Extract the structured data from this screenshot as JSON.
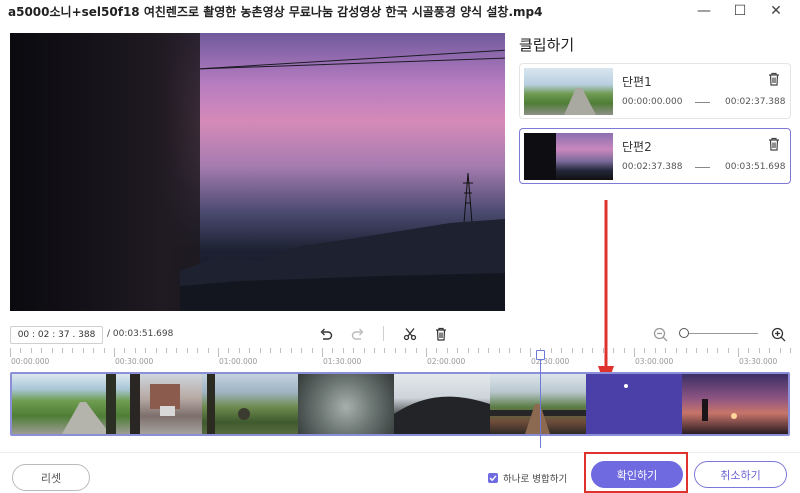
{
  "window": {
    "title": "a5000소니+sel50f18 여친렌즈로 촬영한 농촌영상 무료나눔 감성영상 한국 시골풍경 양식 설창.mp4",
    "min_glyph": "—",
    "max_glyph": "☐",
    "close_glyph": "✕"
  },
  "clip_panel": {
    "title": "클립하기",
    "clips": [
      {
        "name": "단편1",
        "start": "00:00:00.000",
        "end": "00:02:37.388",
        "selected": false
      },
      {
        "name": "단편2",
        "start": "00:02:37.388",
        "end": "00:03:51.698",
        "selected": true
      }
    ]
  },
  "toolbar": {
    "current_time": "00 : 02 : 37 . 388",
    "total_time": "/ 00:03:51.698",
    "icons": [
      "undo-icon",
      "redo-icon",
      "cut-icon",
      "trash-icon",
      "zoom-out-icon",
      "zoom-in-icon"
    ],
    "zoom_level": 0.0
  },
  "ruler": {
    "labels": [
      "00:00.000",
      "00:30.000",
      "01:00.000",
      "01:30.000",
      "02:00.000",
      "02:30.000",
      "03:00.000",
      "03:30.000"
    ]
  },
  "timeline": {
    "playhead_time": "00:02:37.388"
  },
  "footer": {
    "reset_label": "리셋",
    "merge_label": "하나로 병합하기",
    "merge_checked": true,
    "confirm_label": "확인하기",
    "cancel_label": "취소하기"
  },
  "colors": {
    "accent": "#6f6ae0",
    "annotation_red": "#e0322d"
  }
}
